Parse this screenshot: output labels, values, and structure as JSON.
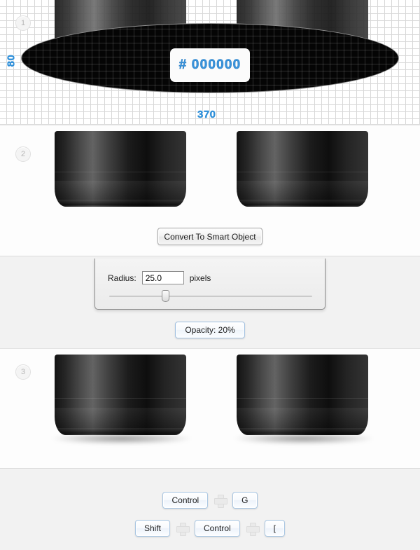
{
  "steps": [
    {
      "number": "1"
    },
    {
      "number": "2"
    },
    {
      "number": "3"
    }
  ],
  "canvas": {
    "hex_label": "# 000000",
    "width_label": "370",
    "height_label": "80",
    "accent_color": "#2f8fd8",
    "shape_fill": "#000000"
  },
  "actions": {
    "smart_object_label": "Convert To Smart Object",
    "opacity_label": "Opacity: 20%"
  },
  "radius_dialog": {
    "label": "Radius:",
    "value": "25.0",
    "units": "pixels"
  },
  "shortcuts": [
    {
      "keys": [
        "Control",
        "G"
      ]
    },
    {
      "keys": [
        "Shift",
        "Control",
        "["
      ]
    }
  ]
}
